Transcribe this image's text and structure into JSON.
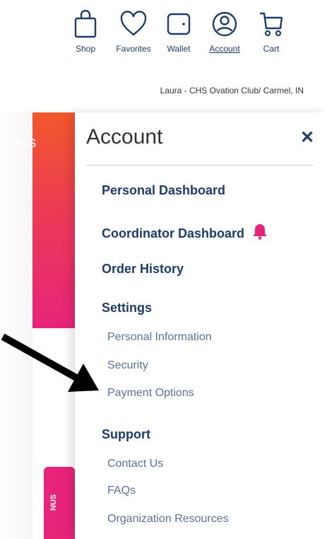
{
  "nav": {
    "items": [
      {
        "label": "Shop",
        "icon": "shopping-bag-icon"
      },
      {
        "label": "Favorites",
        "icon": "heart-icon"
      },
      {
        "label": "Wallet",
        "icon": "wallet-icon"
      },
      {
        "label": "Account",
        "icon": "user-circle-icon"
      },
      {
        "label": "Cart",
        "icon": "cart-icon"
      }
    ],
    "active": "Account"
  },
  "user_line": "Laura - CHS Ovation Club/ Carmel, IN",
  "background": {
    "hero_text": "n eas",
    "bonus_tab_text": "NUS"
  },
  "drawer": {
    "title": "Account",
    "close_icon": "close-icon",
    "links": {
      "personal_dashboard": "Personal Dashboard",
      "coordinator_dashboard": "Coordinator Dashboard",
      "order_history": "Order History"
    },
    "settings": {
      "heading": "Settings",
      "items": [
        "Personal Information",
        "Security",
        "Payment Options"
      ]
    },
    "support": {
      "heading": "Support",
      "items": [
        "Contact Us",
        "FAQs",
        "Organization Resources"
      ]
    }
  },
  "colors": {
    "brand_navy": "#1d3c6e",
    "sub_link": "#5a7399",
    "bell": "#e8247a",
    "hero_orange": "#f2582a",
    "hero_pink": "#e8247a"
  }
}
